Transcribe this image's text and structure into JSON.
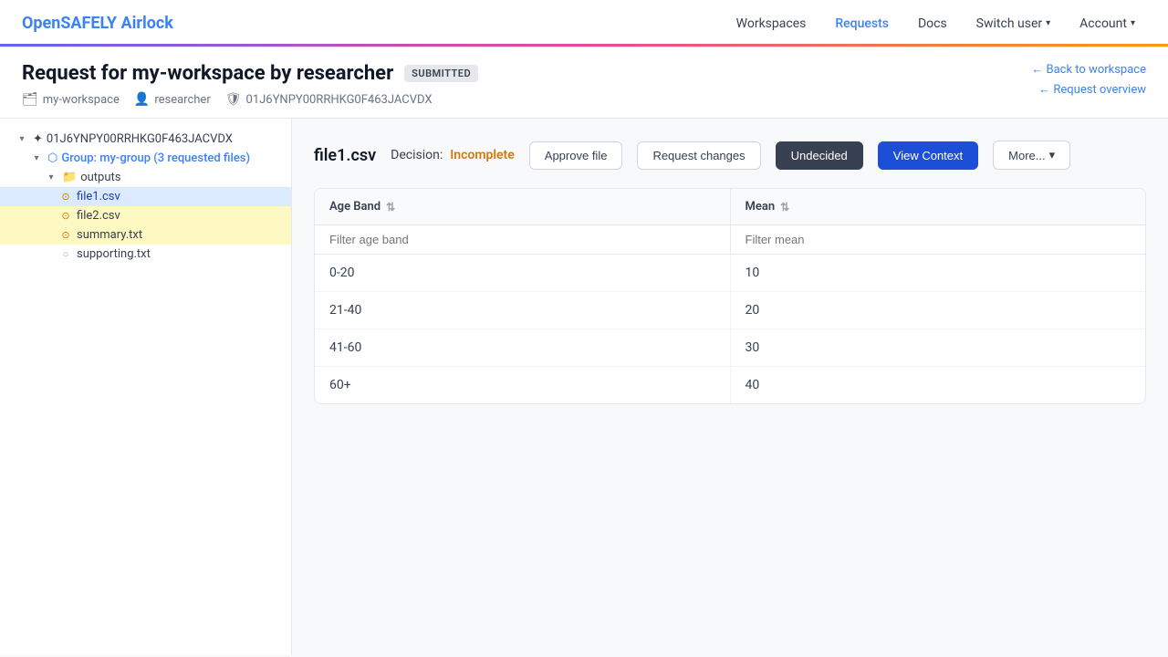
{
  "brand": {
    "open": "OpenSAFELY",
    "airlock": " Airlock"
  },
  "nav": {
    "workspaces": "Workspaces",
    "requests": "Requests",
    "docs": "Docs",
    "switch_user": "Switch user",
    "account": "Account"
  },
  "page": {
    "title_prefix": "Request for my-workspace by",
    "researcher": "researcher",
    "status_badge": "SUBMITTED",
    "back_link": "← Back to workspace",
    "overview_link": "← Request overview",
    "workspace": "my-workspace",
    "request_id": "01J6YNPY00RRHKG0F463JACVDX"
  },
  "file_viewer": {
    "filename": "file1.csv",
    "decision_label": "Decision:",
    "decision_value": "Incomplete",
    "btn_approve": "Approve file",
    "btn_request_changes": "Request changes",
    "btn_undecided": "Undecided",
    "btn_view_context": "View Context",
    "btn_more": "More..."
  },
  "tree": {
    "root_id": "01J6YNPY00RRHKG0F463JACVDX",
    "group_label": "Group: my-group (3 requested files)",
    "outputs_label": "outputs",
    "files": [
      {
        "name": "file1.csv",
        "status": "pending",
        "selected": true
      },
      {
        "name": "file2.csv",
        "status": "pending",
        "selected": false
      },
      {
        "name": "summary.txt",
        "status": "pending",
        "selected": false
      },
      {
        "name": "supporting.txt",
        "status": "normal",
        "selected": false
      }
    ]
  },
  "table": {
    "col1_header": "Age Band",
    "col2_header": "Mean",
    "col1_filter_placeholder": "Filter age band",
    "col2_filter_placeholder": "Filter mean",
    "rows": [
      {
        "age_band": "0-20",
        "mean": "10"
      },
      {
        "age_band": "21-40",
        "mean": "20"
      },
      {
        "age_band": "41-60",
        "mean": "30"
      },
      {
        "age_band": "60+",
        "mean": "40"
      }
    ]
  }
}
